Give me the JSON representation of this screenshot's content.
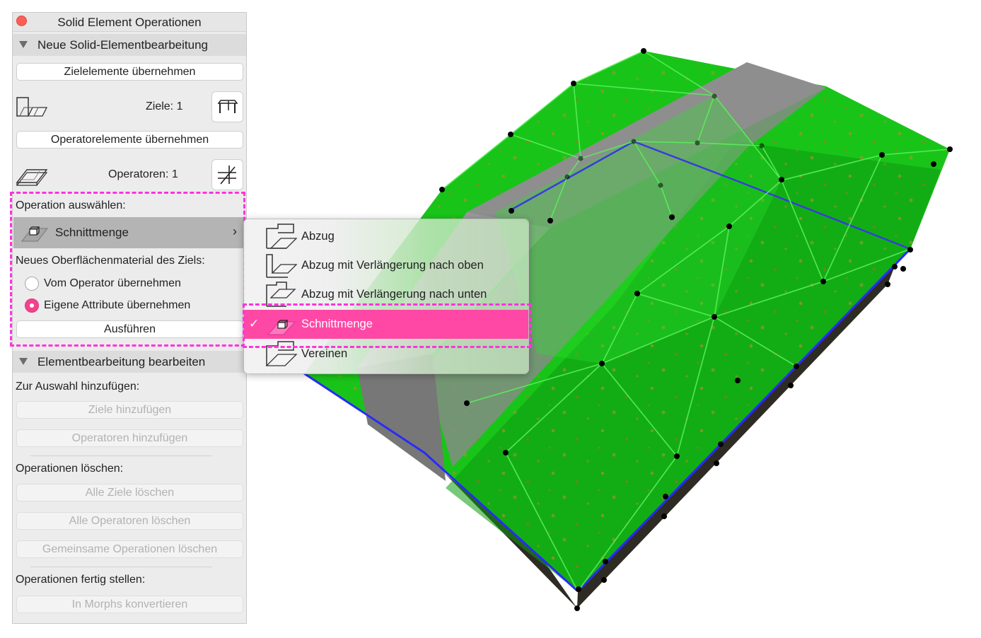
{
  "window": {
    "title": "Solid Element Operationen"
  },
  "section_new": {
    "label": "Neue Solid-Elementbearbeitung"
  },
  "targets": {
    "button_label": "Zielelemente übernehmen",
    "count_label": "Ziele: 1"
  },
  "operators": {
    "button_label": "Operatorelemente übernehmen",
    "count_label": "Operatoren: 1"
  },
  "operation": {
    "label": "Operation auswählen:",
    "selected": "Schnittmenge",
    "surface_label": "Neues Oberflächenmaterial des Ziels:",
    "radio_options": [
      {
        "label": "Vom Operator übernehmen",
        "checked": false
      },
      {
        "label": "Eigene Attribute übernehmen",
        "checked": true
      }
    ],
    "execute_label": "Ausführen"
  },
  "section_edit": {
    "label": "Elementbearbeitung bearbeiten"
  },
  "add": {
    "label": "Zur Auswahl hinzufügen:",
    "targets_btn": "Ziele hinzufügen",
    "operators_btn": "Operatoren hinzufügen"
  },
  "delete": {
    "label": "Operationen löschen:",
    "all_targets_btn": "Alle Ziele löschen",
    "all_operators_btn": "Alle Operatoren löschen",
    "common_btn": "Gemeinsame Operationen löschen"
  },
  "finish": {
    "label": "Operationen fertig stellen:",
    "morph_btn": "In Morphs konvertieren"
  },
  "menu": {
    "items": [
      {
        "label": "Abzug",
        "icon": "subtraction-icon",
        "checked": false
      },
      {
        "label": "Abzug mit Verlängerung nach oben",
        "icon": "subtraction-upwards-icon",
        "checked": false
      },
      {
        "label": "Abzug mit Verlängerung nach unten",
        "icon": "subtraction-downwards-icon",
        "checked": false
      },
      {
        "label": "Schnittmenge",
        "icon": "intersection-icon",
        "checked": true
      },
      {
        "label": "Vereinen",
        "icon": "union-icon",
        "checked": false
      }
    ],
    "check_glyph": "✓"
  },
  "colors": {
    "accent": "#ff48a6",
    "highlight": "#ff33dd",
    "terrain": "#19c419",
    "edge_blue": "#2a2aff"
  }
}
